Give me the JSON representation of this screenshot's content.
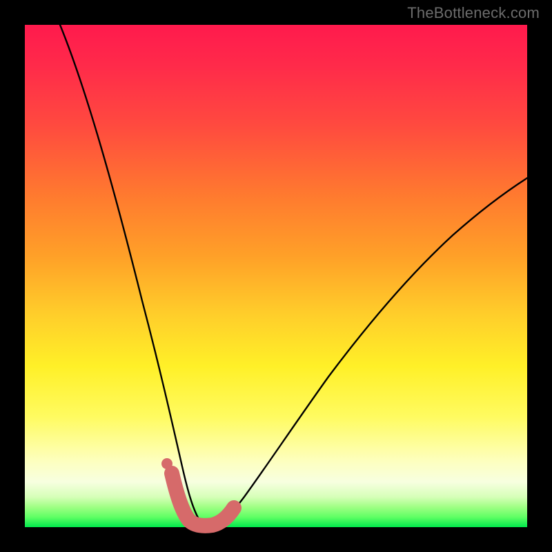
{
  "watermark": "TheBottleneck.com",
  "chart_data": {
    "type": "line",
    "title": "",
    "xlabel": "",
    "ylabel": "",
    "xlim": [
      0,
      100
    ],
    "ylim": [
      0,
      100
    ],
    "grid": false,
    "legend": false,
    "series": [
      {
        "name": "bottleneck-curve",
        "color": "#000000",
        "x": [
          7,
          10,
          13,
          16,
          19,
          22,
          24,
          26,
          28,
          29.5,
          31,
          32.5,
          34,
          35,
          36,
          38,
          40,
          44,
          48,
          54,
          60,
          66,
          72,
          78,
          84,
          90,
          96,
          100
        ],
        "y": [
          100,
          87,
          75,
          63,
          51,
          39,
          30,
          22,
          15,
          10,
          6,
          3,
          1.5,
          0.8,
          0.8,
          1.2,
          2.5,
          5,
          9,
          16,
          24,
          32,
          40,
          47,
          54,
          60,
          65,
          68
        ]
      },
      {
        "name": "marker-band",
        "color": "#d66a6a",
        "x": [
          29,
          30,
          31,
          32,
          33,
          34,
          35,
          36,
          37,
          38,
          39,
          40
        ],
        "y": [
          9,
          5,
          2.5,
          1.2,
          0.8,
          0.8,
          0.8,
          0.9,
          1.5,
          2.5,
          3.5,
          4.5
        ]
      },
      {
        "name": "marker-dot",
        "color": "#d66a6a",
        "x": [
          28.5
        ],
        "y": [
          12
        ]
      }
    ],
    "note": "Values are estimated from pixel positions; axes are unlabeled in the source image so x and y are treated as 0–100 percent of the plot area (left→right, bottom→top)."
  }
}
